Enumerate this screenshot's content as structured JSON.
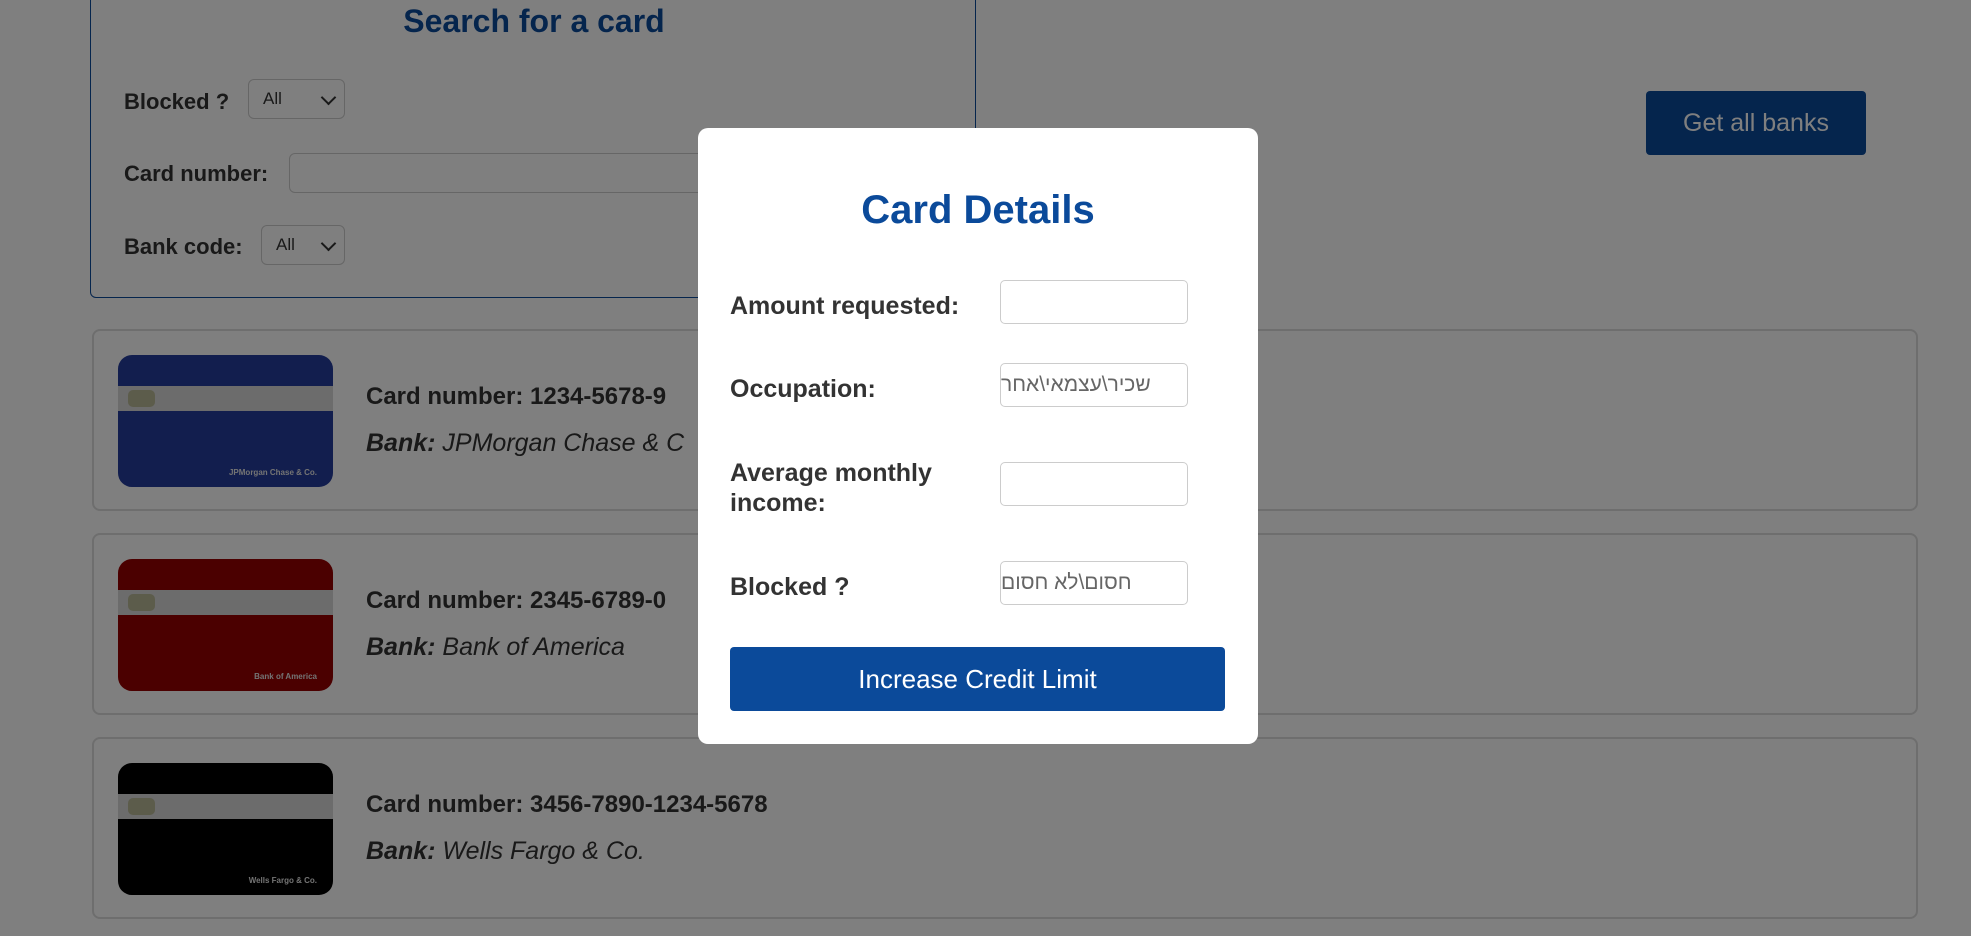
{
  "search": {
    "title": "Search for a card",
    "blocked_label": "Blocked ?",
    "blocked_value": "All",
    "card_number_label": "Card number:",
    "card_number_value": "",
    "bank_code_label": "Bank code:",
    "bank_code_value": "All"
  },
  "header": {
    "get_all_banks": "Get all banks"
  },
  "cards": [
    {
      "number_label": "Card number: 1234-5678-9",
      "bank_label": "Bank:",
      "bank": "JPMorgan Chase & C",
      "card_text": "JPMorgan Chase & Co.",
      "color": "#253d9c"
    },
    {
      "number_label": "Card number: 2345-6789-0",
      "bank_label": "Bank:",
      "bank": "Bank of America",
      "card_text": "Bank of America",
      "color": "#970000"
    },
    {
      "number_label": "Card number: 3456-7890-1234-5678",
      "bank_label": "Bank:",
      "bank": "Wells Fargo & Co.",
      "card_text": "Wells Fargo & Co.",
      "color": "#000000"
    }
  ],
  "modal": {
    "title": "Card Details",
    "amount_label": "Amount requested:",
    "amount_value": "",
    "occupation_label": "Occupation:",
    "occupation_placeholder": "שכיר\\עצמאי\\אחר",
    "income_label": "Average monthly income:",
    "income_value": "",
    "blocked_label": "Blocked ?",
    "blocked_placeholder": "חסום\\לא חסום",
    "submit_label": "Increase Credit Limit"
  },
  "colors": {
    "primary": "#0b4a9a",
    "overlay": "rgba(0,0,0,0.5)"
  }
}
